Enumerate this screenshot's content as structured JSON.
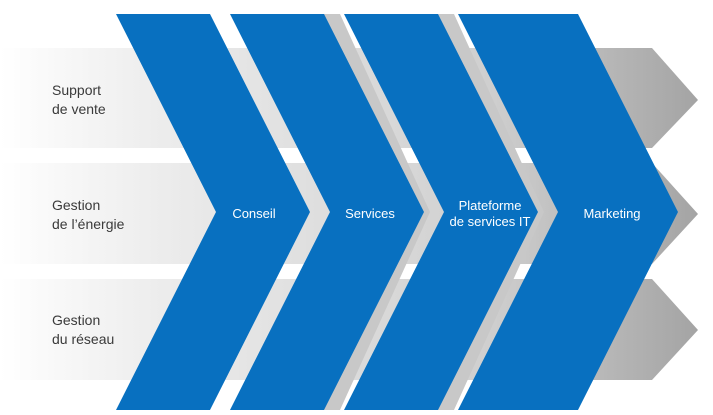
{
  "diagram": {
    "rows": [
      {
        "label_line1": "Support",
        "label_line2": "de vente"
      },
      {
        "label_line1": "Gestion",
        "label_line2": "de l’énergie"
      },
      {
        "label_line1": "Gestion",
        "label_line2": "du réseau"
      }
    ],
    "chevrons": [
      {
        "line1": "Conseil",
        "line2": ""
      },
      {
        "line1": "Services",
        "line2": ""
      },
      {
        "line1": "Plateforme",
        "line2": "de services IT"
      },
      {
        "line1": "Marketing",
        "line2": ""
      }
    ],
    "colors": {
      "chevron_blue": "#0870c0",
      "band_gray": "#d0d0d0",
      "band_light": "#f0f0f0",
      "band_dark": "#a6a6a6",
      "label_text": "#3a3a3a"
    }
  }
}
